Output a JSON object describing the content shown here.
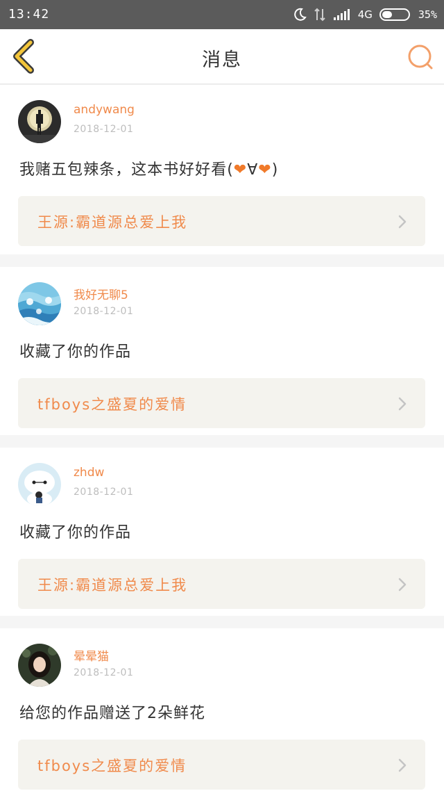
{
  "status_bar": {
    "time": "13:42",
    "network": "4G",
    "battery": "35%"
  },
  "header": {
    "title": "消息",
    "back_icon": "chevron-left-icon",
    "search_icon": "search-icon"
  },
  "colors": {
    "accent": "#f08a4b",
    "back_icon": "#f3c53a"
  },
  "messages": [
    {
      "username": "andywang",
      "date": "2018-12-01",
      "text": "我赌五包辣条，这本书好好看(❤∀❤)",
      "book": "王源:霸道源总爱上我",
      "avatar": "avatar-moon-figure"
    },
    {
      "username": "我好无聊5",
      "date": "2018-12-01",
      "text": "收藏了你的作品",
      "book": "tfboys之盛夏的爱情",
      "avatar": "avatar-blue-pattern"
    },
    {
      "username": "zhdw",
      "date": "2018-12-01",
      "text": "收藏了你的作品",
      "book": "王源:霸道源总爱上我",
      "avatar": "avatar-baymax"
    },
    {
      "username": "晕晕猫",
      "date": "2018-12-01",
      "text": "给您的作品赠送了2朵鲜花",
      "book": "tfboys之盛夏的爱情",
      "avatar": "avatar-girl-photo"
    }
  ]
}
